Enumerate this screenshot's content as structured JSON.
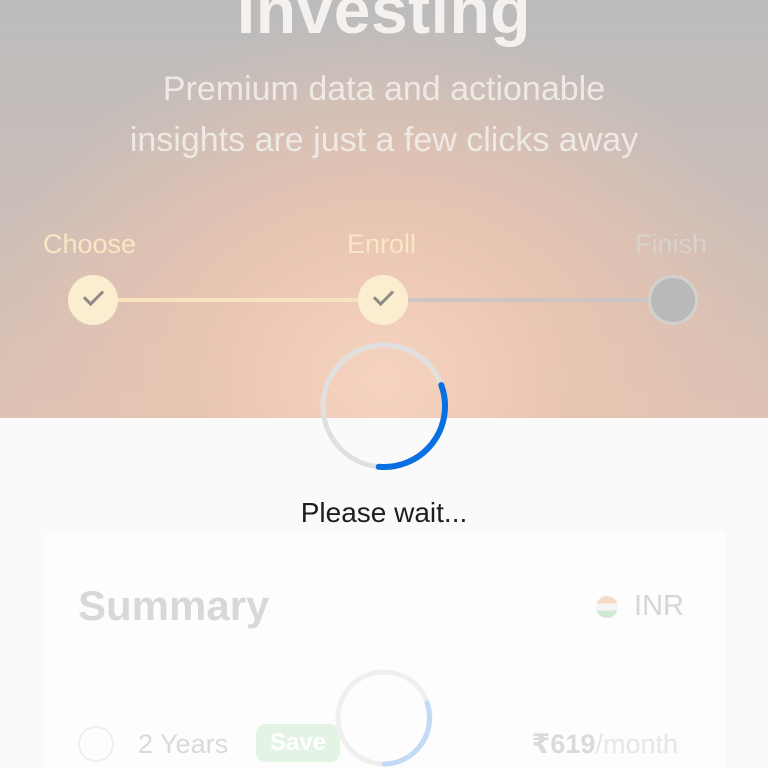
{
  "hero": {
    "title": "Investing",
    "subtitle_line1": "Premium data and actionable",
    "subtitle_line2": "insights are just a few clicks away"
  },
  "stepper": {
    "steps": [
      {
        "label": "Choose",
        "status": "done"
      },
      {
        "label": "Enroll",
        "status": "done"
      },
      {
        "label": "Finish",
        "status": "pending"
      }
    ]
  },
  "loading": {
    "text": "Please wait..."
  },
  "summary": {
    "title": "Summary",
    "currency": "INR",
    "currency_flag_icon": "india-flag-icon",
    "plan": {
      "term": "2 Years",
      "badge": "Save",
      "price": "₹619",
      "period": "/month"
    }
  },
  "colors": {
    "spinner_active": "#0a6fe0",
    "spinner_track": "#e0e0e0",
    "step_done": "#fbedcf",
    "step_pending": "#b9b9b9"
  }
}
